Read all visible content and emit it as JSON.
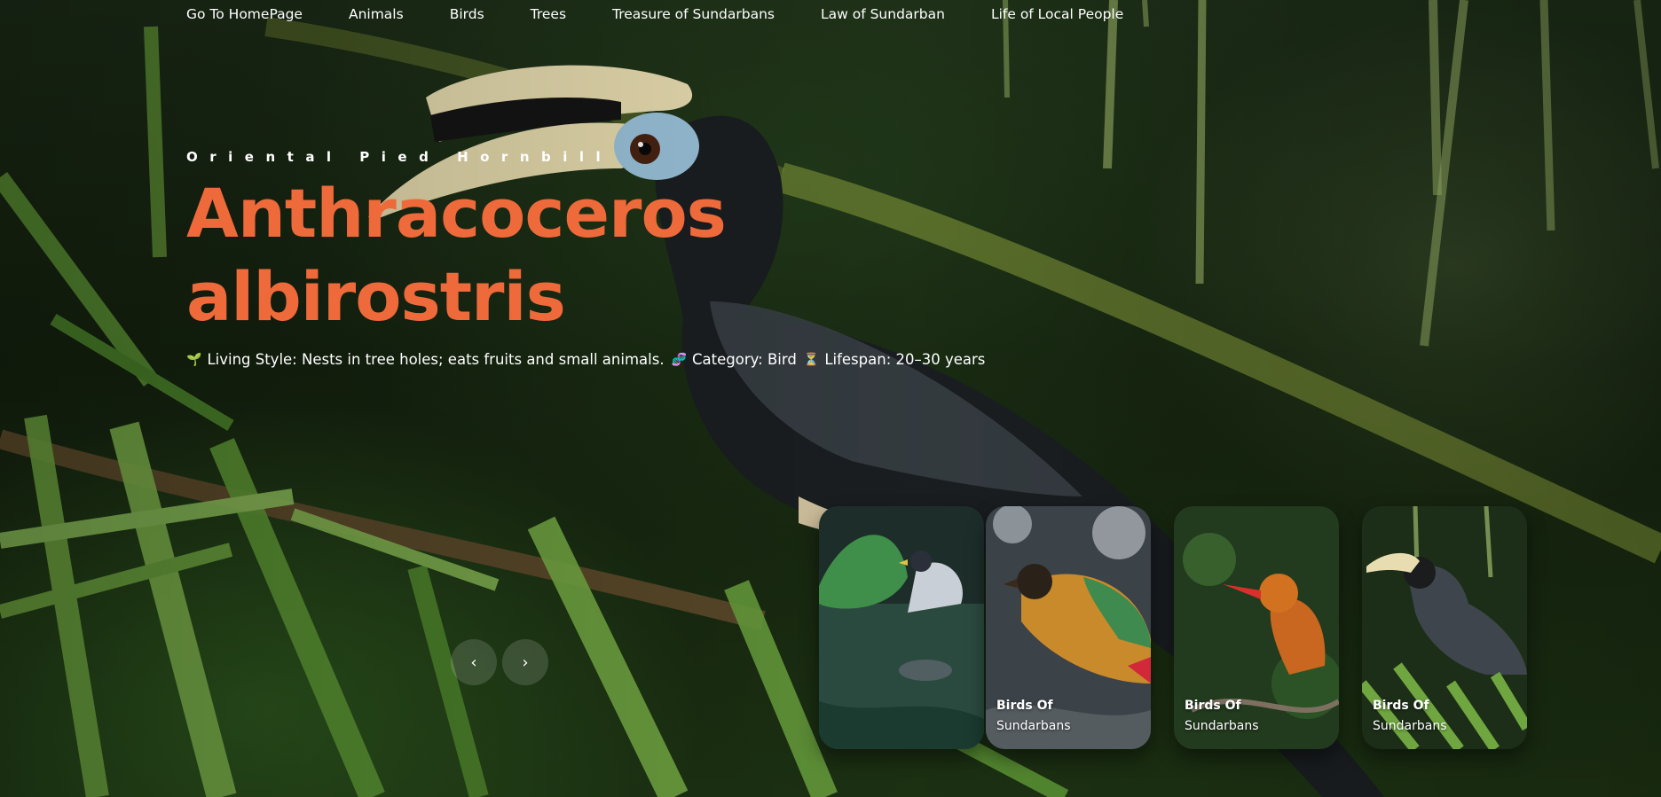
{
  "nav": {
    "items": [
      {
        "label": "Go To HomePage"
      },
      {
        "label": "Animals"
      },
      {
        "label": "Birds"
      },
      {
        "label": "Trees"
      },
      {
        "label": "Treasure of Sundarbans"
      },
      {
        "label": "Law of Sundarban"
      },
      {
        "label": "Life of Local People"
      }
    ]
  },
  "hero": {
    "eyebrow": "Oriental Pied Hornbill",
    "title_line1": "Anthracoceros",
    "title_line2": "albirostris",
    "info": {
      "living_icon": "🌱",
      "living": "Living Style: Nests in tree holes; eats fruits and small animals.",
      "category_icon": "🧬",
      "category": "Category: Bird",
      "lifespan_icon": "⏳",
      "lifespan": "Lifespan: 20–30 years"
    }
  },
  "controls": {
    "prev": "‹",
    "next": "›"
  },
  "cards": [
    {
      "line1": "",
      "line2": ""
    },
    {
      "line1": "Birds Of",
      "line2": "Sundarbans"
    },
    {
      "line1": "Birds Of",
      "line2": "Sundarbans"
    },
    {
      "line1": "Birds Of",
      "line2": "Sundarbans"
    }
  ],
  "colors": {
    "accent": "#ee6a3a",
    "text": "#ffffff"
  }
}
